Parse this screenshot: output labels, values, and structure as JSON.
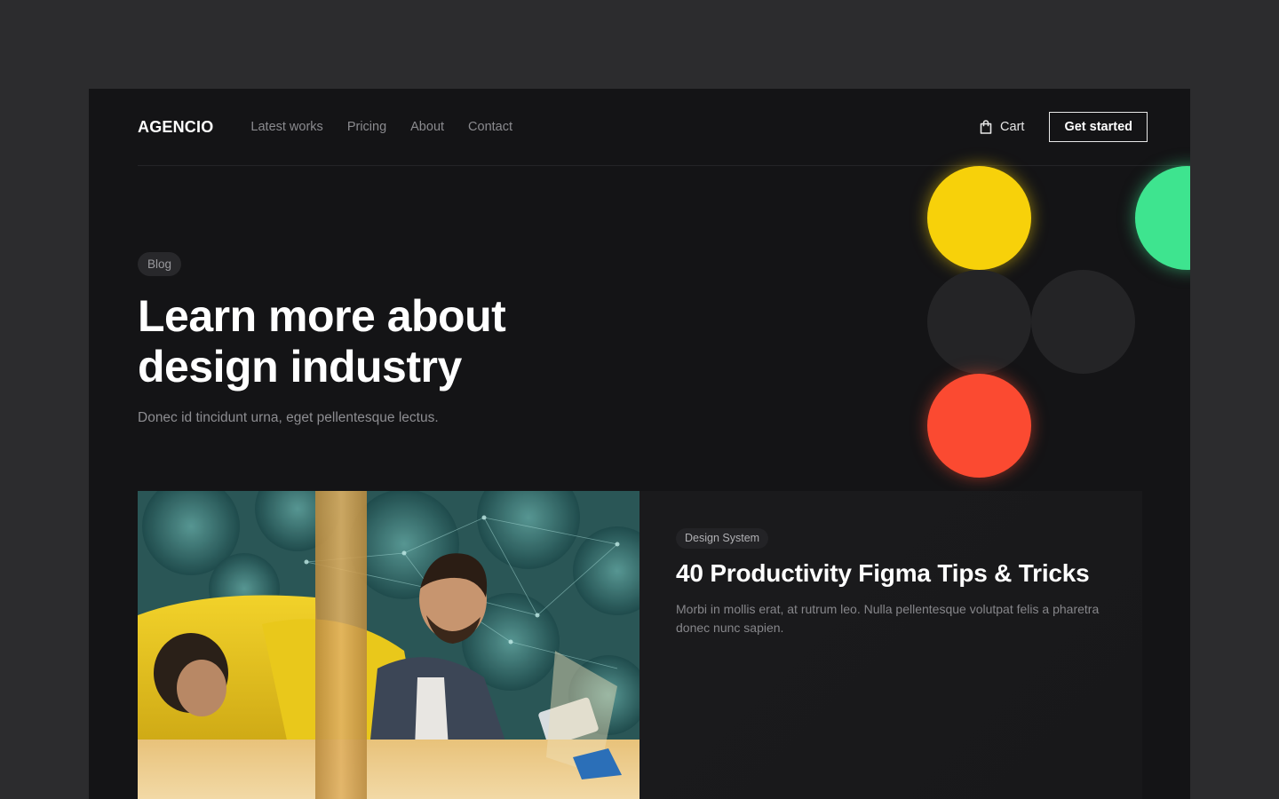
{
  "nav": {
    "logo": "AGENCIO",
    "links": [
      "Latest works",
      "Pricing",
      "About",
      "Contact"
    ],
    "cart_label": "Cart",
    "cta_label": "Get started"
  },
  "hero": {
    "badge": "Blog",
    "title_line1": "Learn more about",
    "title_line2": "design industry",
    "subtitle": "Donec id tincidunt urna, eget pellentesque lectus."
  },
  "decor": {
    "circle_colors": [
      "#f7d10a",
      "#3ee48f",
      "#242426",
      "#242426",
      "#fb4a31"
    ]
  },
  "featured": {
    "tag": "Design System",
    "title": "40 Productivity Figma Tips & Tricks",
    "description": "Morbi in mollis erat, at rutrum leo. Nulla pellentesque volutpat felis a pharetra donec nunc sapien."
  },
  "colors": {
    "page_bg": "#2c2c2e",
    "frame_bg": "#141416",
    "yellow": "#f7d10a",
    "green": "#3ee48f",
    "red": "#fb4a31"
  }
}
